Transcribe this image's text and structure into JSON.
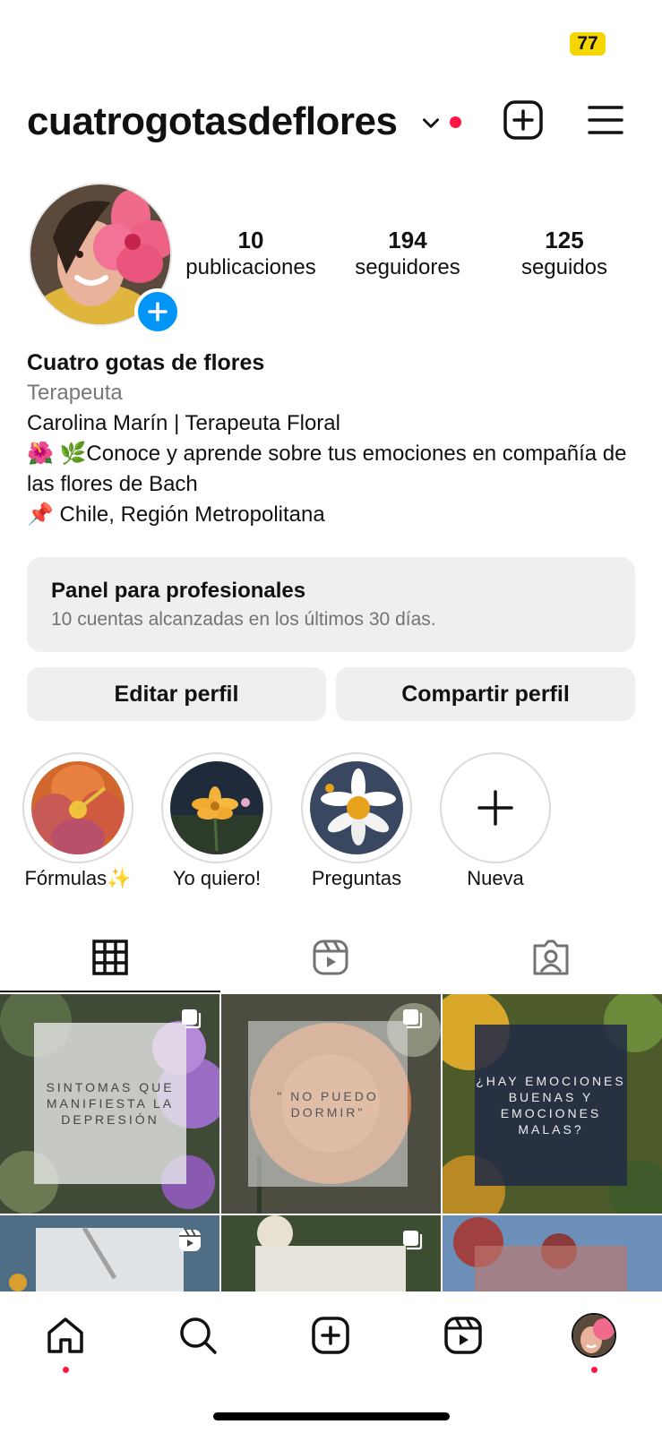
{
  "status_bar": {
    "badge": "77"
  },
  "header": {
    "username": "cuatrogotasdeflores"
  },
  "stats": [
    {
      "count": "10",
      "label": "publicaciones"
    },
    {
      "count": "194",
      "label": "seguidores"
    },
    {
      "count": "125",
      "label": "seguidos"
    }
  ],
  "bio": {
    "name": "Cuatro gotas de flores",
    "category": "Terapeuta",
    "line1": "Carolina Marín | Terapeuta Floral",
    "line2": "🌺 🌿Conoce y aprende sobre tus emociones en compañía de las flores de Bach",
    "line3": "📌 Chile, Región Metropolitana"
  },
  "dashboard": {
    "title": "Panel para profesionales",
    "subtitle": "10 cuentas alcanzadas en los últimos 30 días."
  },
  "actions": {
    "edit": "Editar perfil",
    "share": "Compartir perfil"
  },
  "highlights": [
    {
      "label": "Fórmulas✨"
    },
    {
      "label": "Yo quiero!"
    },
    {
      "label": "Preguntas"
    },
    {
      "label": "Nueva"
    }
  ],
  "posts": [
    {
      "text": "SINTOMAS QUE MANIFIESTA LA DEPRESIÓN"
    },
    {
      "text": "\" NO PUEDO DORMIR\""
    },
    {
      "text": "¿HAY EMOCIONES BUENAS Y EMOCIONES MALAS?"
    }
  ],
  "colors": {
    "accent": "#0095f6",
    "notification": "#ff1744",
    "badge": "#f5d600"
  },
  "icons": {
    "header": [
      "chevron-down-icon",
      "create-post-icon",
      "menu-icon"
    ],
    "tabs": [
      "grid-icon",
      "reels-icon",
      "tagged-icon"
    ],
    "nav": [
      "home-icon",
      "search-icon",
      "create-icon",
      "reels-icon",
      "profile-avatar"
    ]
  }
}
